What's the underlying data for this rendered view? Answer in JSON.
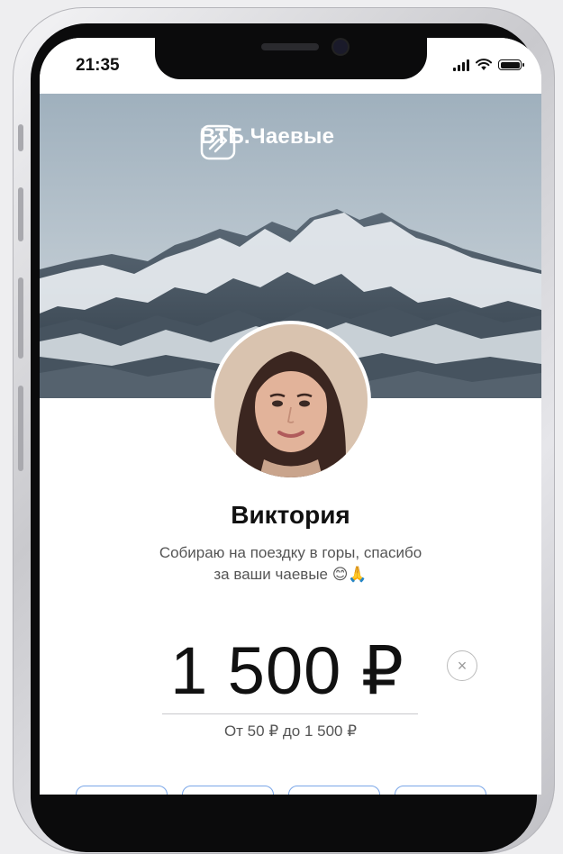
{
  "status_bar": {
    "time": "21:35"
  },
  "brand": {
    "name": "ВТБ.Чаевые"
  },
  "profile": {
    "name": "Виктория",
    "bio_line1": "Собираю на поездку в горы, спасибо",
    "bio_line2": "за ваши чаевые 😊🙏"
  },
  "tip": {
    "amount": "1 500 ₽",
    "clear_icon": "×",
    "range": "От 50 ₽ до 1 500 ₽"
  },
  "icons": {
    "signal": "signal-icon",
    "wifi": "wifi-icon",
    "battery": "battery-icon",
    "brand_logo": "vtb-logo-icon",
    "clear": "close-circle-icon"
  },
  "colors": {
    "accent_chip_border": "#7aa6e8",
    "text_primary": "#111111",
    "text_secondary": "#555555"
  }
}
